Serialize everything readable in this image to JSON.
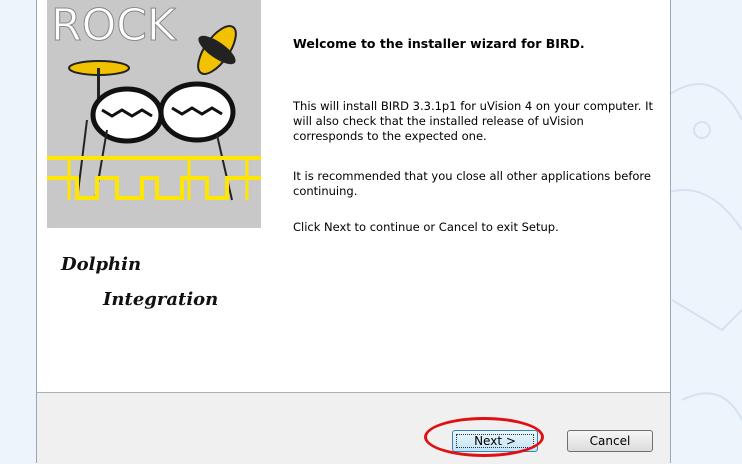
{
  "banner": {
    "rock_text": "ROCK",
    "company_line1": "Dolphin",
    "company_line2": "Integration"
  },
  "welcome": {
    "title": "Welcome to the installer wizard for BIRD.",
    "paragraph1": "This will install BIRD 3.3.1p1 for uVision 4 on your computer. It will also check that the installed release of uVision corresponds to the expected one.",
    "paragraph2": "It is recommended that you close all other applications before  continuing.",
    "paragraph3": "Click Next to continue or Cancel to exit Setup."
  },
  "buttons": {
    "next": "Next >",
    "cancel": "Cancel"
  },
  "colors": {
    "highlight": "#e01010",
    "banner_bg": "#c8c8c8",
    "circuit": "#ffe600"
  }
}
